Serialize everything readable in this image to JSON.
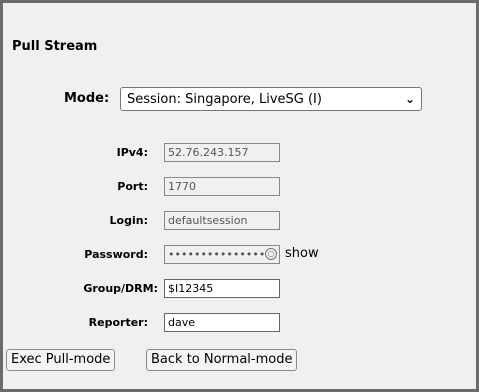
{
  "title": "Pull Stream",
  "mode": {
    "label": "Mode:",
    "selected": "Session: Singapore, LiveSG (I)"
  },
  "fields": {
    "ipv4": {
      "label": "IPv4:",
      "value": "52.76.243.157"
    },
    "port": {
      "label": "Port:",
      "value": "1770"
    },
    "login": {
      "label": "Login:",
      "value": "defaultsession"
    },
    "password": {
      "label": "Password:",
      "value": "•••••••••••••••",
      "show_label": "show"
    },
    "group": {
      "label": "Group/DRM:",
      "value": "$I12345"
    },
    "reporter": {
      "label": "Reporter:",
      "value": "dave"
    }
  },
  "buttons": {
    "exec": "Exec Pull-mode",
    "back": "Back to Normal-mode"
  }
}
